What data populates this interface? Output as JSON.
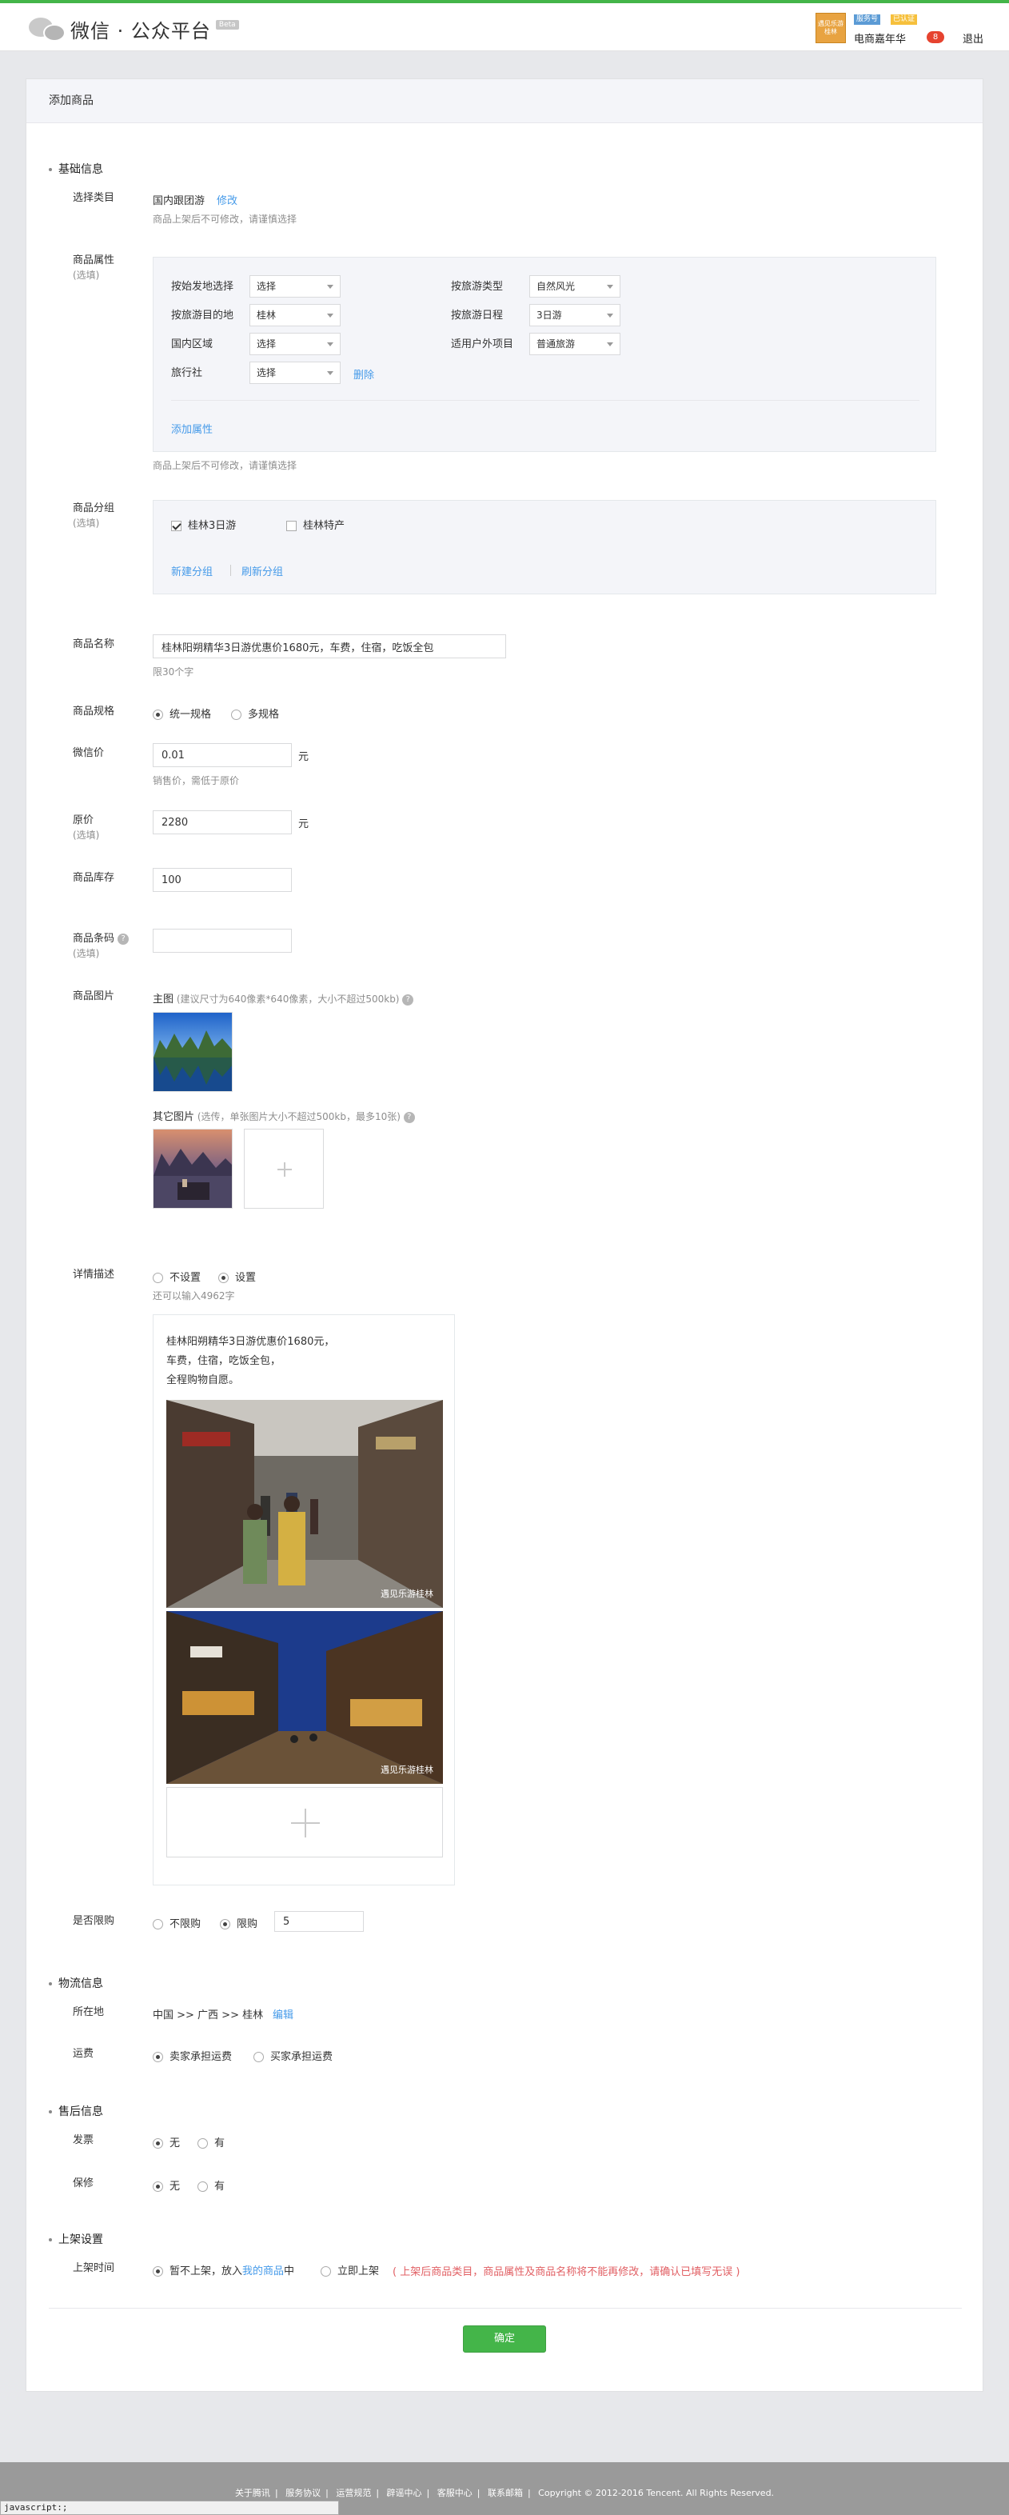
{
  "header": {
    "logo_text": "微信 · 公众平台",
    "beta": "Beta",
    "avatar_text": "遇见乐游桂林",
    "tag_service": "服务号",
    "tag_verified": "已认证",
    "account_name": "电商嘉年华",
    "notification_count": "8",
    "logout": "退出"
  },
  "page": {
    "title": "添加商品"
  },
  "basic": {
    "section_title": "基础信息",
    "category_label": "选择类目",
    "category_value": "国内跟团游",
    "category_edit": "修改",
    "category_tip": "商品上架后不可修改，请谨慎选择",
    "attr_label": "商品属性",
    "attr_optional": "(选填)",
    "attrs": [
      {
        "label": "按始发地选择",
        "value": "选择"
      },
      {
        "label": "按旅游目的地",
        "value": "桂林"
      },
      {
        "label": "国内区域",
        "value": "选择"
      },
      {
        "label": "旅行社",
        "value": "选择"
      }
    ],
    "attrs_right": [
      {
        "label": "按旅游类型",
        "value": "自然风光"
      },
      {
        "label": "按旅游日程",
        "value": "3日游"
      },
      {
        "label": "适用户外项目",
        "value": "普通旅游"
      }
    ],
    "attr_delete": "删除",
    "attr_add": "添加属性",
    "attr_tip": "商品上架后不可修改，请谨慎选择",
    "group_label": "商品分组",
    "group_optional": "(选填)",
    "groups": [
      {
        "name": "桂林3日游",
        "checked": true
      },
      {
        "name": "桂林特产",
        "checked": false
      }
    ],
    "group_new": "新建分组",
    "group_refresh": "刷新分组",
    "name_label": "商品名称",
    "name_value": "桂林阳朔精华3日游优惠价1680元，车费，住宿，吃饭全包",
    "name_tip": "限30个字",
    "spec_label": "商品规格",
    "spec_options": [
      "统一规格",
      "多规格"
    ],
    "wx_price_label": "微信价",
    "wx_price_value": "0.01",
    "currency": "元",
    "wx_price_tip": "销售价，需低于原价",
    "orig_price_label": "原价",
    "orig_price_optional": "(选填)",
    "orig_price_value": "2280",
    "stock_label": "商品库存",
    "stock_value": "100",
    "barcode_label": "商品条码",
    "barcode_optional": "(选填)",
    "barcode_help": "?",
    "image_label": "商品图片",
    "main_image_title": "主图",
    "main_image_tip": "(建议尺寸为640像素*640像素，大小不超过500kb)",
    "other_image_title": "其它图片",
    "other_image_tip": "(选传，单张图片大小不超过500kb，最多10张)",
    "help": "?",
    "plus": "+"
  },
  "detail": {
    "label": "详情描述",
    "options": [
      "不设置",
      "设置"
    ],
    "tip": "还可以输入4962字",
    "preview_lines": [
      "桂林阳朔精华3日游优惠价1680元，",
      "车费，住宿，吃饭全包，",
      "全程购物自愿。"
    ],
    "watermark": "遇见乐游桂林"
  },
  "limit": {
    "label": "是否限购",
    "options": [
      "不限购",
      "限购"
    ],
    "value": "5"
  },
  "logistics": {
    "section_title": "物流信息",
    "location_label": "所在地",
    "location_value": "中国 >> 广西 >> 桂林",
    "location_edit": "编辑",
    "freight_label": "运费",
    "freight_options": [
      "卖家承担运费",
      "买家承担运费"
    ]
  },
  "aftersale": {
    "section_title": "售后信息",
    "invoice_label": "发票",
    "warranty_label": "保修",
    "options": [
      "无",
      "有"
    ]
  },
  "shelf": {
    "section_title": "上架设置",
    "time_label": "上架时间",
    "opt1_pre": "暂不上架，放入",
    "opt1_link": "我的商品",
    "opt1_post": "中",
    "opt2": "立即上架",
    "warning": "( 上架后商品类目，商品属性及商品名称将不能再修改，请确认已填写无误 )"
  },
  "actions": {
    "confirm": "确定"
  },
  "footer": {
    "links": [
      "关于腾讯",
      "服务协议",
      "运营规范",
      "辟谣中心",
      "客服中心",
      "联系邮箱"
    ],
    "copyright": "Copyright © 2012-2016 Tencent. All Rights Reserved."
  },
  "statusbar": "javascript:;",
  "colors": {
    "accent_green": "#44b549",
    "link_blue": "#459ae9",
    "warning_red": "#e15f63"
  }
}
